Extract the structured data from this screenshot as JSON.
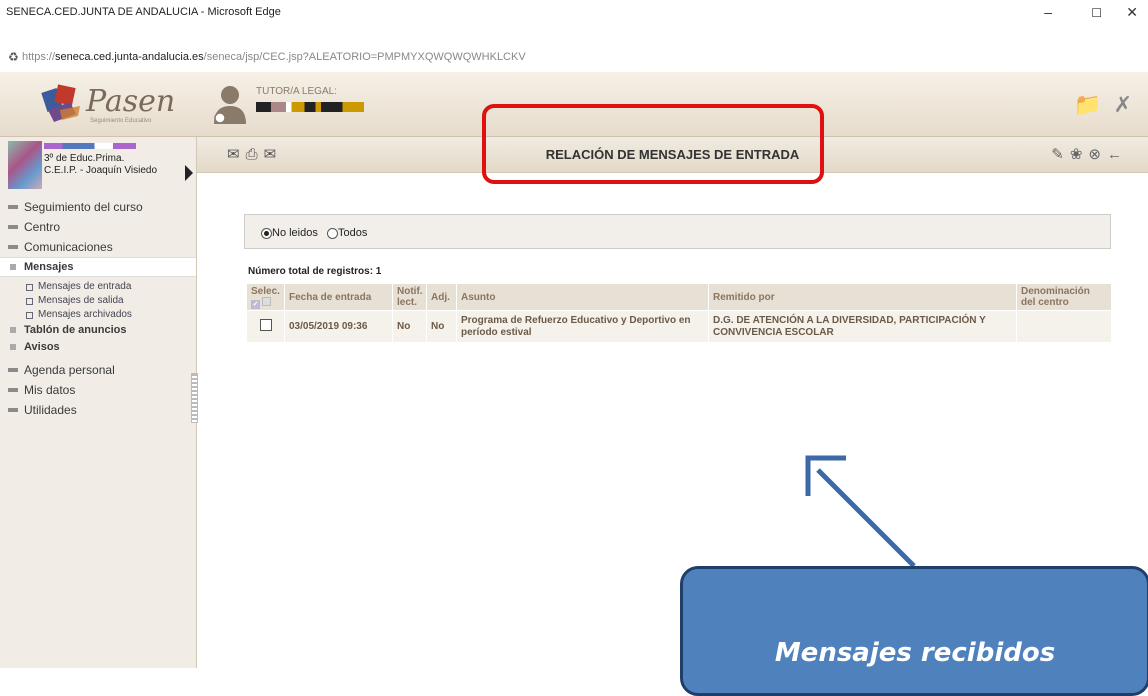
{
  "window": {
    "title": "SENECA.CED.JUNTA DE ANDALUCIA - Microsoft Edge",
    "min_icon": "minimize-icon",
    "max_icon": "maximize-icon",
    "close_icon": "close-icon"
  },
  "address": {
    "host_prefix": "https://",
    "host": "seneca.ced.junta-andalucia.es",
    "path": "/seneca/jsp/CEC.jsp?ALEATORIO=PMPMYXQWQWQWHKLCKV",
    "lock_icon": "lock-icon"
  },
  "header": {
    "logo": "Pasen",
    "logo_sub": "Seguimiento Educativo",
    "tutor_label": "TUTOR/A LEGAL:",
    "icons": [
      "folder-icon",
      "tools-icon"
    ]
  },
  "user": {
    "line1": "3º de Educ.Prima.",
    "line2": "C.E.I.P. - Joaquín Visiedo"
  },
  "menu": {
    "seguimiento": "Seguimiento del curso",
    "centro": "Centro",
    "comunicaciones": "Comunicaciones",
    "mensajes": "Mensajes",
    "entrada": "Mensajes de entrada",
    "salida": "Mensajes de salida",
    "archivados": "Mensajes archivados",
    "tablon": "Tablón de anuncios",
    "avisos": "Avisos",
    "agenda": "Agenda personal",
    "misdatos": "Mis datos",
    "utilidades": "Utilidades"
  },
  "toolbar": {
    "title": "RELACIÓN DE MENSAJES DE ENTRADA",
    "left_icons": [
      "new-message-icon",
      "print-icon",
      "mail-icon"
    ],
    "right_icons": [
      "signature-icon",
      "bug-icon",
      "cancel-icon",
      "back-icon"
    ]
  },
  "filter": {
    "opt_unread": "No leidos",
    "opt_all": "Todos",
    "selected": "No leidos"
  },
  "table": {
    "count_label": "Número total de registros: 1",
    "headers": {
      "selec": "Selec.",
      "fecha": "Fecha de entrada",
      "notif": "Notif. lect.",
      "adj": "Adj.",
      "asunto": "Asunto",
      "remitido": "Remitido por",
      "denominacion": "Denominación del centro"
    },
    "rows": [
      {
        "fecha": "03/05/2019 09:36",
        "notif": "No",
        "adj": "No",
        "asunto": "Programa de Refuerzo Educativo y Deportivo en período estival",
        "remitido": "D.G. DE ATENCIÓN A LA DIVERSIDAD, PARTICIPACIÓN Y CONVIVENCIA ESCOLAR",
        "denominacion": ""
      }
    ]
  },
  "annotation": {
    "callout_text": "Mensajes recibidos",
    "highlight_color": "#e01010",
    "callout_color": "#4f81bd"
  }
}
